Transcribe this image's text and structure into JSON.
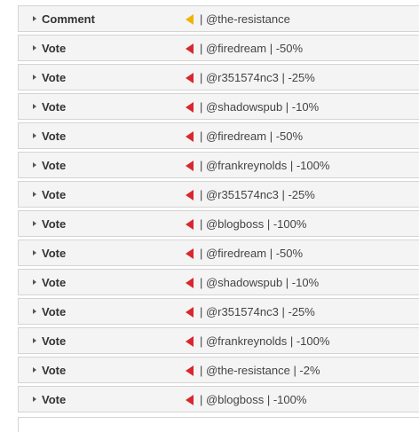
{
  "activity": {
    "rows": [
      {
        "kind": "Comment",
        "flag_color": "#f0b400",
        "user": "@the-resistance",
        "info": "| @the-resistance"
      },
      {
        "kind": "Vote",
        "flag_color": "#d9272e",
        "user": "@firedream",
        "weight": "-50%",
        "info": "| @firedream | -50%"
      },
      {
        "kind": "Vote",
        "flag_color": "#d9272e",
        "user": "@r351574nc3",
        "weight": "-25%",
        "info": "| @r351574nc3 | -25%"
      },
      {
        "kind": "Vote",
        "flag_color": "#d9272e",
        "user": "@shadowspub",
        "weight": "-10%",
        "info": "| @shadowspub | -10%"
      },
      {
        "kind": "Vote",
        "flag_color": "#d9272e",
        "user": "@firedream",
        "weight": "-50%",
        "info": "| @firedream | -50%"
      },
      {
        "kind": "Vote",
        "flag_color": "#d9272e",
        "user": "@frankreynolds",
        "weight": "-100%",
        "info": "| @frankreynolds | -100%"
      },
      {
        "kind": "Vote",
        "flag_color": "#d9272e",
        "user": "@r351574nc3",
        "weight": "-25%",
        "info": "| @r351574nc3 | -25%"
      },
      {
        "kind": "Vote",
        "flag_color": "#d9272e",
        "user": "@blogboss",
        "weight": "-100%",
        "info": "| @blogboss | -100%"
      },
      {
        "kind": "Vote",
        "flag_color": "#d9272e",
        "user": "@firedream",
        "weight": "-50%",
        "info": "| @firedream | -50%"
      },
      {
        "kind": "Vote",
        "flag_color": "#d9272e",
        "user": "@shadowspub",
        "weight": "-10%",
        "info": "| @shadowspub | -10%"
      },
      {
        "kind": "Vote",
        "flag_color": "#d9272e",
        "user": "@r351574nc3",
        "weight": "-25%",
        "info": "| @r351574nc3 | -25%"
      },
      {
        "kind": "Vote",
        "flag_color": "#d9272e",
        "user": "@frankreynolds",
        "weight": "-100%",
        "info": "| @frankreynolds | -100%"
      },
      {
        "kind": "Vote",
        "flag_color": "#d9272e",
        "user": "@the-resistance",
        "weight": "-2%",
        "info": "| @the-resistance | -2%"
      },
      {
        "kind": "Vote",
        "flag_color": "#d9272e",
        "user": "@blogboss",
        "weight": "-100%",
        "info": "| @blogboss | -100%"
      }
    ]
  }
}
